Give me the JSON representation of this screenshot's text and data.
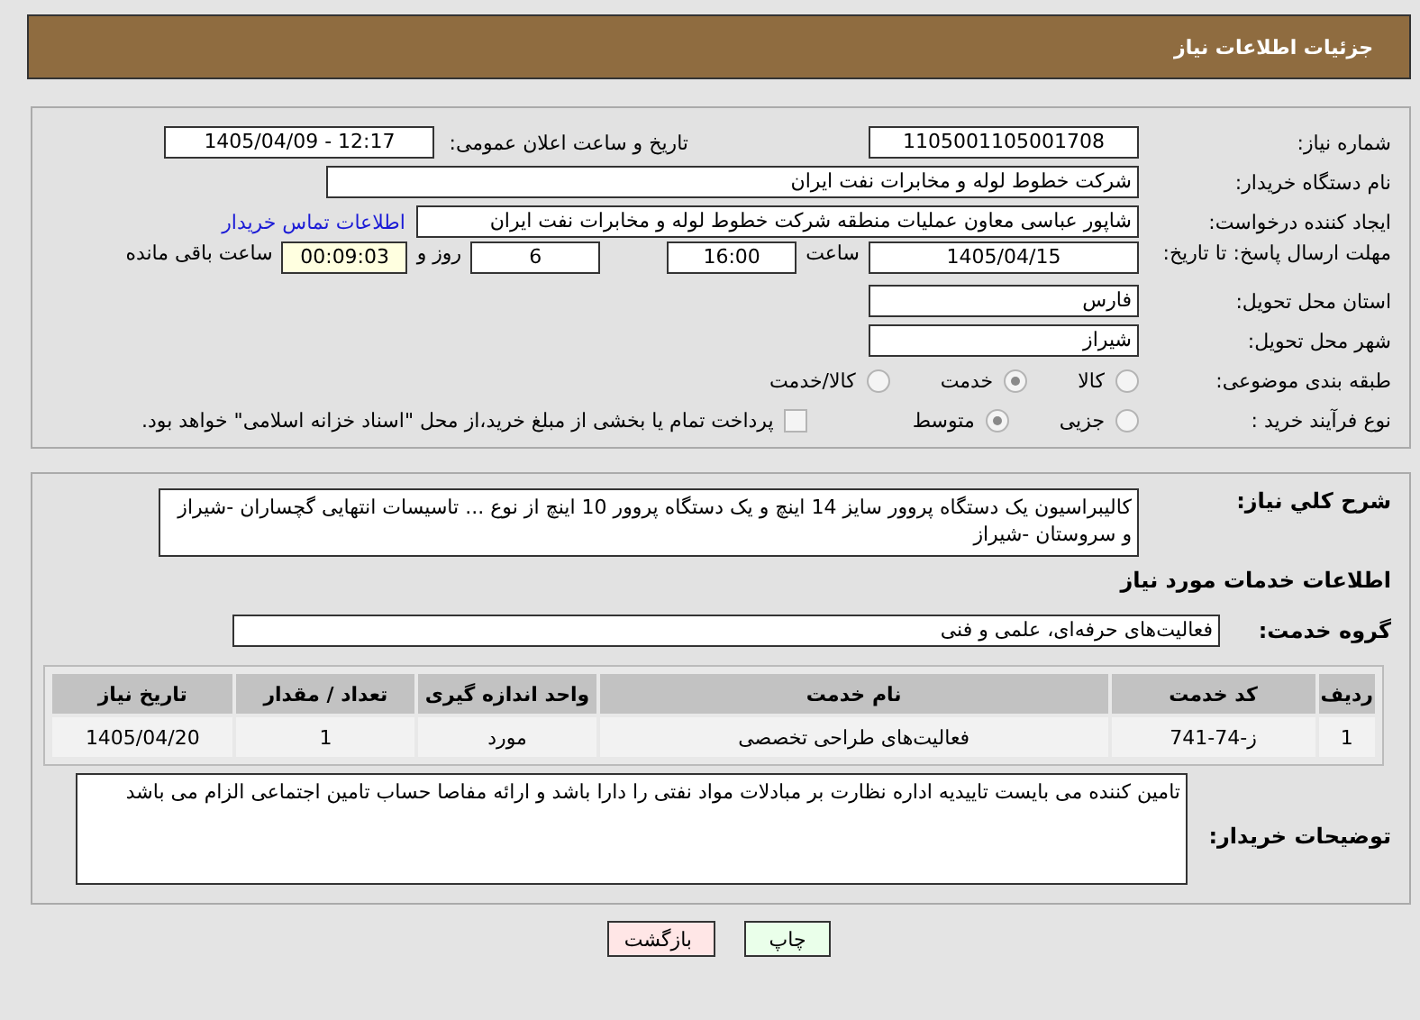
{
  "header": {
    "title": "جزئیات اطلاعات نیاز"
  },
  "need_number": {
    "label": "شماره نیاز:",
    "value": "1105001105001708"
  },
  "announce": {
    "label": "تاریخ و ساعت اعلان عمومی:",
    "value": "1405/04/09 - 12:17"
  },
  "buyer": {
    "label": "نام دستگاه خریدار:",
    "value": "شرکت خطوط لوله و مخابرات نفت ایران"
  },
  "creator": {
    "label": "ایجاد کننده درخواست:",
    "value": "شاپور  عباسی معاون عملیات منطقه شرکت خطوط لوله و مخابرات نفت ایران",
    "link": "اطلاعات تماس خریدار"
  },
  "deadline": {
    "label": "مهلت ارسال پاسخ: تا تاریخ:",
    "date": "1405/04/15",
    "time_label": "ساعت",
    "time": "16:00",
    "days": "6",
    "days_label": "روز و",
    "remaining": "00:09:03",
    "remaining_label": "ساعت باقی مانده"
  },
  "province": {
    "label": "استان محل تحویل:",
    "value": "فارس"
  },
  "city": {
    "label": "شهر محل تحویل:",
    "value": "شیراز"
  },
  "category": {
    "label": "طبقه بندی موضوعی:",
    "options": [
      {
        "label": "کالا",
        "selected": false
      },
      {
        "label": "خدمت",
        "selected": true
      },
      {
        "label": "کالا/خدمت",
        "selected": false
      }
    ]
  },
  "process": {
    "label": "نوع فرآیند خرید :",
    "options": [
      {
        "label": "جزیی",
        "selected": false
      },
      {
        "label": "متوسط",
        "selected": true
      }
    ],
    "payment": {
      "checked": false,
      "text": "پرداخت تمام یا بخشی از مبلغ خرید،از محل \"اسناد خزانه اسلامی\" خواهد بود."
    }
  },
  "description": {
    "label": "شرح كلي نیاز:",
    "value": "کالیبراسیون یک دستگاه پروور سایز 14 اینچ و یک دستگاه پروور 10 اینچ از نوع ... تاسیسات انتهایی گچساران -شیراز و سروستان -شیراز"
  },
  "services_heading": "اطلاعات خدمات مورد نیاز",
  "service_group": {
    "label": "گروه خدمت:",
    "value": "فعالیت‌های حرفه‌ای، علمی و فنی"
  },
  "table": {
    "columns": [
      "ردیف",
      "کد خدمت",
      "نام خدمت",
      "واحد اندازه گیری",
      "تعداد / مقدار",
      "تاریخ نیاز"
    ],
    "rows": [
      [
        "1",
        "ز-74-741",
        "فعالیت‌های طراحی تخصصی",
        "مورد",
        "1",
        "1405/04/20"
      ]
    ]
  },
  "buyer_notes": {
    "label": "توضیحات خریدار:",
    "value": "تامین کننده می بایست تاییدیه اداره نظارت بر مبادلات مواد نفتی را دارا باشد و ارائه مفاصا حساب تامین اجتماعی الزام می باشد"
  },
  "buttons": [
    {
      "label": "چاپ",
      "kind": "print"
    },
    {
      "label": "بازگشت",
      "kind": "back"
    }
  ]
}
